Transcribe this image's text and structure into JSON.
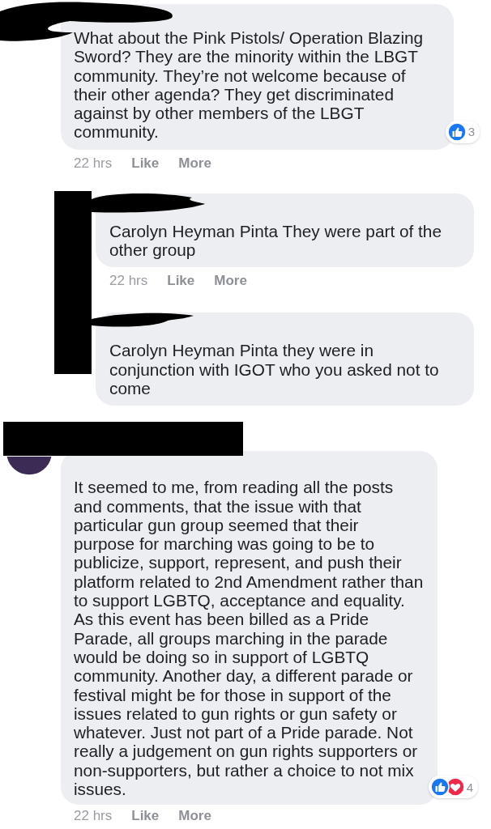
{
  "comments": [
    {
      "kind": "top",
      "text": "What about the Pink Pistols/ Operation Blazing Sword? They are the minority within the LBGT community. They’re not welcome because of their other agenda? They get discriminated against by other members of the LBGT community.",
      "time": "22 hrs",
      "like": "Like",
      "more": "More",
      "reactions": {
        "icons": [
          {
            "kind": "like"
          }
        ],
        "count": "3"
      }
    },
    {
      "kind": "reply",
      "text": "Carolyn Heyman Pinta They were part of the other group",
      "time": "22 hrs",
      "like": "Like",
      "more": "More"
    },
    {
      "kind": "reply",
      "text": "Carolyn Heyman Pinta they were in conjunction with IGOT who you asked not to come"
    },
    {
      "kind": "top",
      "avatar": true,
      "text": "It seemed to me, from reading all the posts and comments, that the issue with that particular gun group seemed that their purpose for marching was going to be to publicize, support, represent, and push their platform related to 2nd Amendment rather than to support LGBTQ, acceptance and equality. As this event has been billed as a Pride Parade, all groups marching in the parade would be doing so in support of LGBTQ community. Another day, a different parade or festival might be for those in support of the issues related to gun rights or gun safety or whatever. Just not part of a Pride parade. Not really a judgement on gun rights supporters or non-supporters, but rather a choice to not mix issues.",
      "time": "22 hrs",
      "like": "Like",
      "more": "More",
      "reactions": {
        "icons": [
          {
            "kind": "like"
          },
          {
            "kind": "love"
          }
        ],
        "count": "4"
      }
    }
  ]
}
